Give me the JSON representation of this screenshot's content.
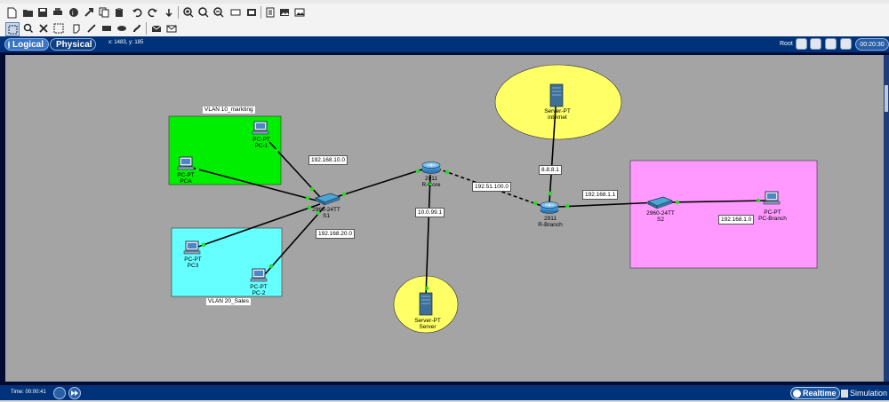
{
  "top_toolbar": {
    "icons": [
      "new-file-icon",
      "open-folder-icon",
      "save-icon",
      "print-icon",
      "activity-wizard-icon",
      "pdu-icon",
      "copy-icon",
      "paste-icon",
      "undo-icon",
      "redo-icon",
      "zoom-in-icon",
      "zoom-reset-icon",
      "zoom-out-icon",
      "rectangle-draw-icon",
      "palette-icon",
      "viewport-icon",
      "image-icon"
    ]
  },
  "tool_row": {
    "icons": [
      "select-icon",
      "inspect-icon",
      "delete-icon",
      "resize-icon",
      "note-icon",
      "line-draw-icon",
      "rectangle-tool-icon",
      "ellipse-tool-icon",
      "freeform-icon",
      "simple-pdu-icon",
      "complex-pdu-icon"
    ]
  },
  "nav": {
    "logical_label": "Logical",
    "physical_label": "Physical",
    "coords_text": "x: 1483, y: 185",
    "root_label": "Root",
    "clock_text": "00:20:30"
  },
  "areas": {
    "vlan10_title": "VLAN 10_markting",
    "vlan20_title": "VLAN 20_Sales",
    "colors": {
      "vlan10": "#00ee00",
      "vlan20": "#66ffff",
      "branch": "#ff99ff",
      "server_zone": "#ffff66",
      "canvas": "#a4a4a4"
    }
  },
  "devices": {
    "pc1": {
      "type": "PC-PT",
      "name": "PC-1"
    },
    "pca": {
      "type": "PC-PT",
      "name": "PCA"
    },
    "pc3": {
      "type": "PC-PT",
      "name": "PC3"
    },
    "pc2": {
      "type": "PC-PT",
      "name": "PC-2"
    },
    "s1": {
      "type": "2960-24TT",
      "name": "S1"
    },
    "rcore": {
      "type": "2911",
      "name": "R-Core"
    },
    "server": {
      "type": "Server-PT",
      "name": "Server"
    },
    "internet": {
      "type": "Server-PT",
      "name": "internet"
    },
    "rbranch": {
      "type": "2911",
      "name": "R-Branch"
    },
    "s2": {
      "type": "2960-24TT",
      "name": "S2"
    },
    "pcbranch": {
      "type": "PC-PT",
      "name": "PC-Branch"
    }
  },
  "ip_labels": {
    "vlan10_net": "192.168.10.0",
    "vlan20_net": "192.168.20.0",
    "server_net": "10.0.99.1",
    "wan_net": "192.51.100.0",
    "internet_ip": "8.8.8.1",
    "branch_gw": "192.168.1.1",
    "branch_net": "192.168.1.0"
  },
  "bottom": {
    "time_text": "Time: 00:00:41",
    "realtime_label": "Realtime",
    "simulation_label": "Simulation"
  }
}
